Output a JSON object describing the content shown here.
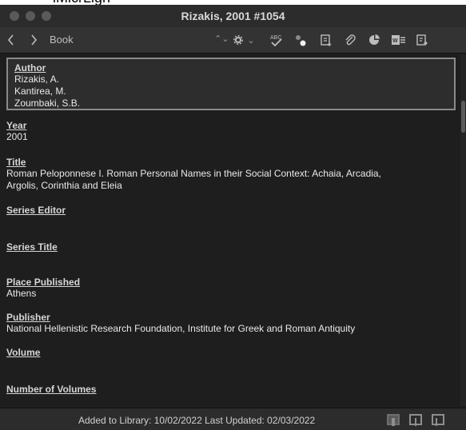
{
  "top_strip_text": "iMicrLign",
  "window": {
    "title": "Rizakis, 2001 #1054"
  },
  "toolbar": {
    "back_icon": "chevron-left-icon",
    "forward_icon": "chevron-right-icon",
    "reference_type": "Book",
    "reference_type_arrows": "⌃⌄",
    "settings_arrow": "⌄"
  },
  "fields": {
    "author": {
      "label": "Author",
      "lines": [
        "Rizakis, A.",
        "Kantirea, M.",
        "Zoumbaki, S.B."
      ]
    },
    "year": {
      "label": "Year",
      "value": "2001"
    },
    "title": {
      "label": "Title",
      "lines": [
        "Roman Peloponnese I. Roman Personal Names in their Social Context: Achaia, Arcadia,",
        "Argolis, Corinthia and Eleia"
      ]
    },
    "series_editor": {
      "label": "Series Editor",
      "value": ""
    },
    "series_title": {
      "label": "Series Title",
      "value": ""
    },
    "place_published": {
      "label": "Place Published",
      "value": "Athens"
    },
    "publisher": {
      "label": "Publisher",
      "value": "National Hellenistic Research Foundation, Institute for Greek and Roman Antiquity"
    },
    "volume": {
      "label": "Volume",
      "value": ""
    },
    "number_of_volumes": {
      "label": "Number of Volumes",
      "value": ""
    }
  },
  "status": {
    "text": "Added to Library: 10/02/2022   Last Updated: 02/03/2022"
  },
  "colors": {
    "window_bg": "#1e1e1e",
    "toolbar_bg": "#333333",
    "text": "#e9e9e9"
  }
}
